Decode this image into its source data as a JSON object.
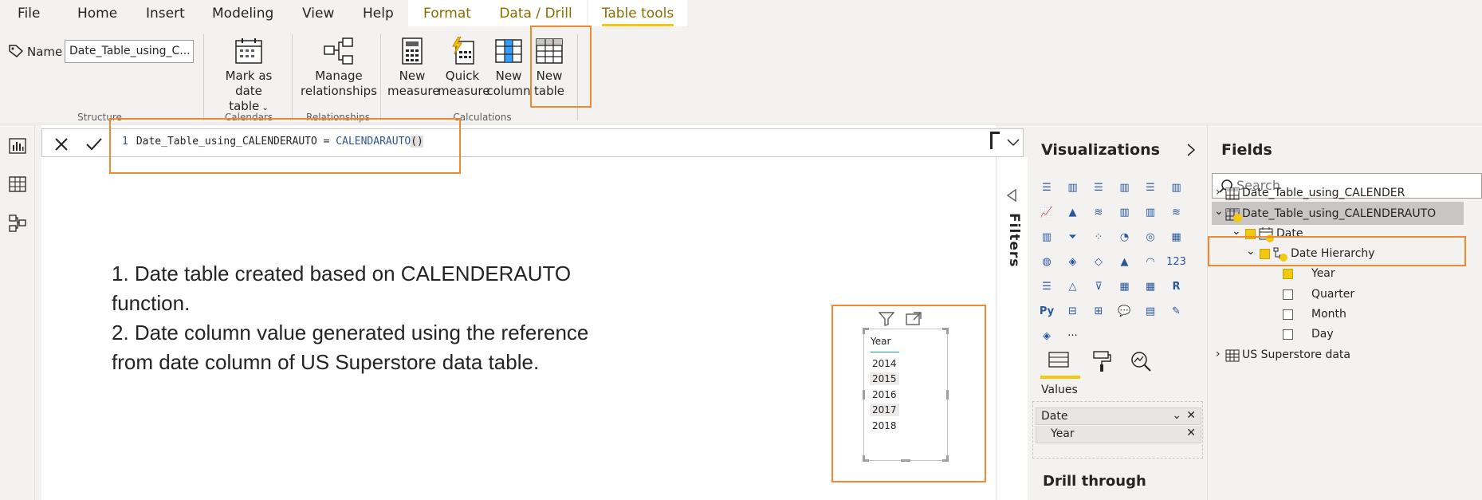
{
  "menu": {
    "items": [
      "File",
      "Home",
      "Insert",
      "Modeling",
      "View",
      "Help"
    ],
    "context_tabs": [
      "Format",
      "Data / Drill",
      "Table tools"
    ]
  },
  "ribbon": {
    "name_label": "Name",
    "name_value": "Date_Table_using_C...",
    "mark_date_line1": "Mark as date",
    "mark_date_line2": "table",
    "manage_line1": "Manage",
    "manage_line2": "relationships",
    "new_measure_line1": "New",
    "new_measure_line2": "measure",
    "quick_measure_line1": "Quick",
    "quick_measure_line2": "measure",
    "new_column_line1": "New",
    "new_column_line2": "column",
    "new_table_line1": "New",
    "new_table_line2": "table",
    "groups": [
      "Structure",
      "Calendars",
      "Relationships",
      "Calculations"
    ]
  },
  "formula": {
    "line_number": "1",
    "table_name": "Date_Table_using_CALENDERAUTO",
    "operator": " = ",
    "function_name": "CALENDARAUTO",
    "parens": "()"
  },
  "note": {
    "line1": "1. Date table created based on CALENDERAUTO",
    "line2": "function.",
    "line3": "2. Date column value generated using the reference",
    "line4": "from date column of US Superstore data table."
  },
  "slicer": {
    "title": "Year",
    "items": [
      "2014",
      "2015",
      "2016",
      "2017",
      "2018"
    ]
  },
  "filters": {
    "label": "Filters"
  },
  "visualizations": {
    "title": "Visualizations",
    "values_label": "Values",
    "well_field": "Date",
    "well_sub": "Year",
    "drill_label": "Drill through",
    "more": "···"
  },
  "fields": {
    "title": "Fields",
    "search_placeholder": "Search",
    "tables": [
      {
        "name": "Date_Table_using_CALENDER"
      },
      {
        "name": "Date_Table_using_CALENDERAUTO"
      },
      {
        "name": "US Superstore data"
      }
    ],
    "date_field": "Date",
    "hierarchy": "Date Hierarchy",
    "levels": [
      {
        "name": "Year",
        "checked": true
      },
      {
        "name": "Quarter",
        "checked": false
      },
      {
        "name": "Month",
        "checked": false
      },
      {
        "name": "Day",
        "checked": false
      }
    ]
  },
  "colors": {
    "accent": "#f2c811",
    "highlight": "#f08a32",
    "context_tab_text": "#8a6d00",
    "icon_blue": "#2b579a"
  }
}
